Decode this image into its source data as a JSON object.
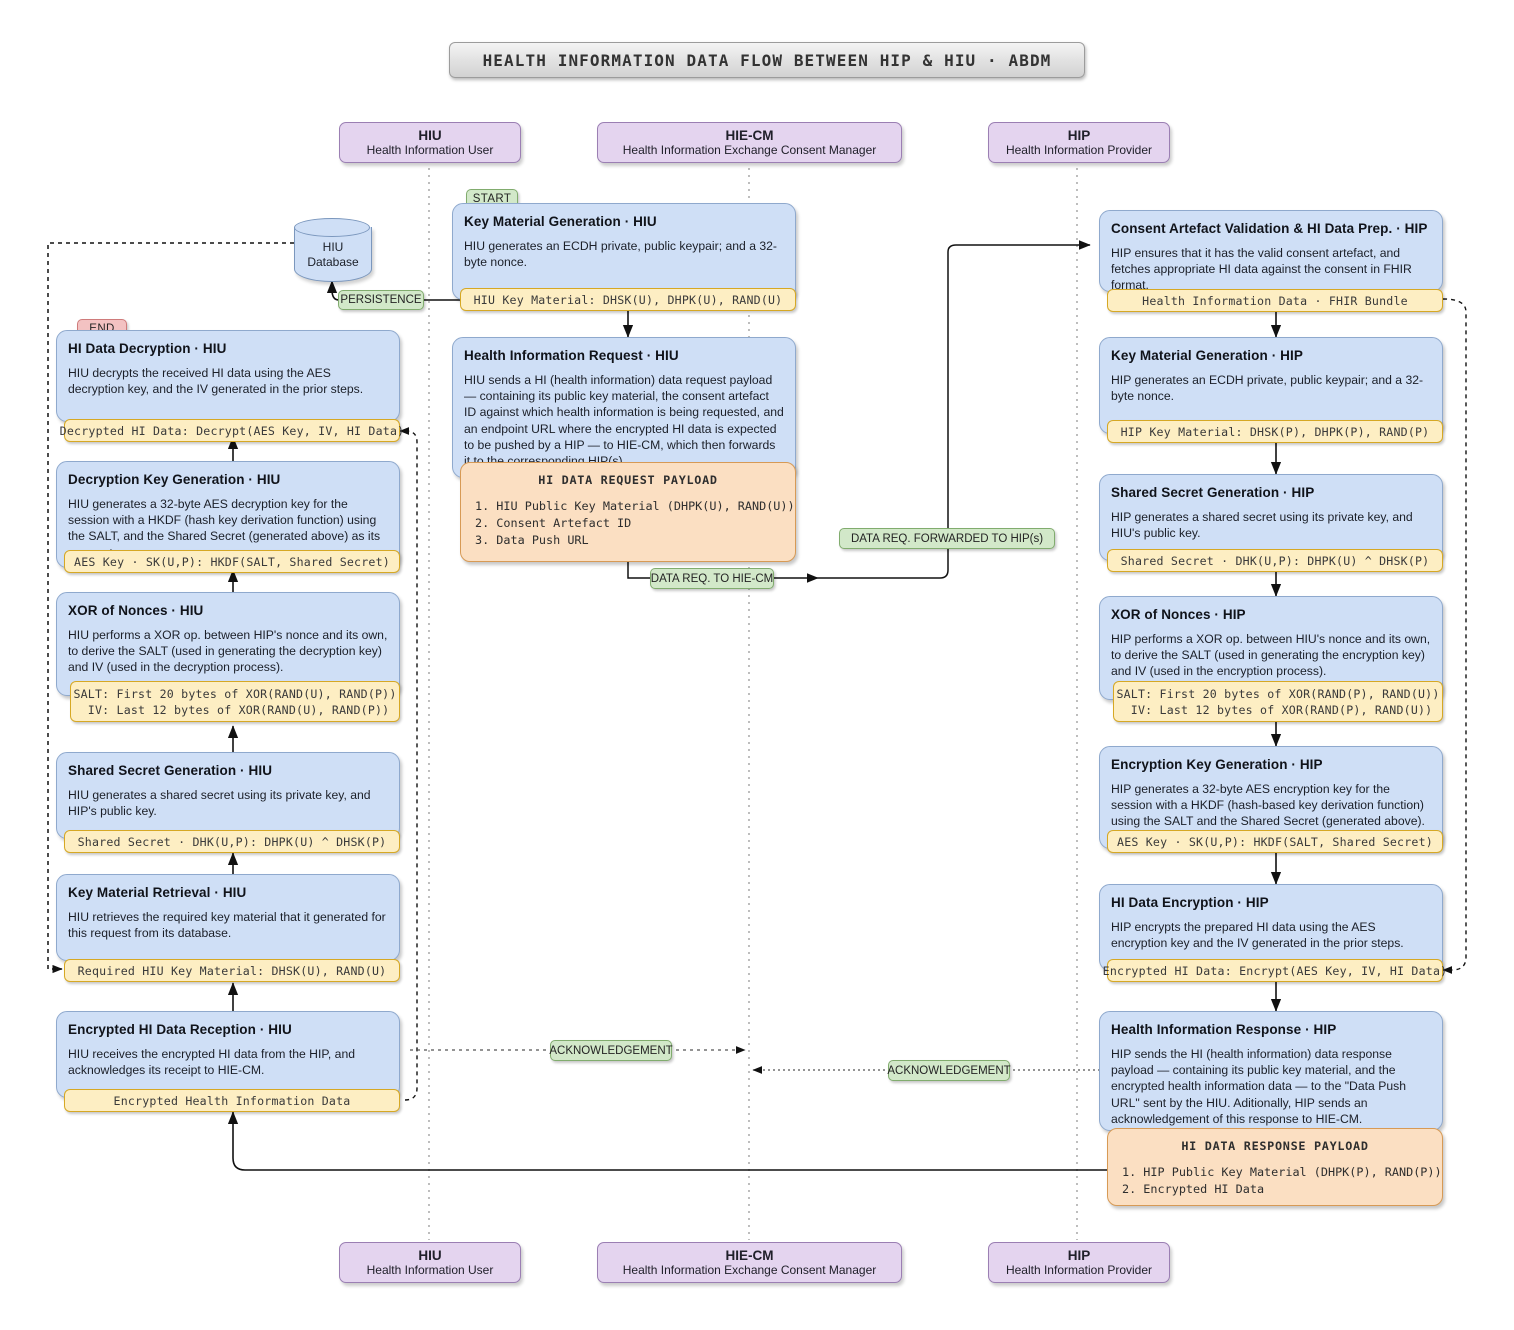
{
  "title": "HEALTH INFORMATION DATA FLOW BETWEEN HIP & HIU · ABDM",
  "participants": [
    {
      "abbr": "HIU",
      "full": "Health Information User"
    },
    {
      "abbr": "HIE-CM",
      "full": "Health Information Exchange Consent Manager"
    },
    {
      "abbr": "HIP",
      "full": "Health Information Provider"
    }
  ],
  "database": {
    "line1": "HIU",
    "line2": "Database"
  },
  "tags": {
    "start": "START",
    "end": "END",
    "persistence": "PERSISTENCE",
    "data_req_to_cm": "DATA REQ. TO HIE-CM",
    "data_req_forwarded": "DATA REQ. FORWARDED TO HIP(s)",
    "ack_left": "ACKNOWLEDGEMENT",
    "ack_right": "ACKNOWLEDGEMENT"
  },
  "middle": {
    "key_material_generation_hiu": {
      "title": "Key Material Generation · HIU",
      "body": "HIU generates an ECDH private, public keypair; and a 32-byte nonce.",
      "artifact": "HIU Key Material: DHSK(U), DHPK(U), RAND(U)"
    },
    "health_information_request_hiu": {
      "title": "Health Information Request · HIU",
      "body": "HIU sends a HI (health information) data request payload — containing its public key material, the consent artefact ID against which health information is being requested, and an endpoint URL where the encrypted HI data is expected to be pushed by a HIP — to HIE-CM, which then forwards it to the corresponding HIP(s).",
      "payload_title": "HI DATA REQUEST PAYLOAD",
      "payload_items": [
        "1. HIU Public Key Material (DHPK(U), RAND(U))",
        "2. Consent Artefact ID",
        "3. Data Push URL"
      ]
    }
  },
  "hiu_steps": [
    {
      "title": "HI Data Decryption · HIU",
      "body": "HIU decrypts the received HI data using the AES decryption key, and the IV generated in the prior steps.",
      "artifact": "Decrypted HI Data: Decrypt(AES Key, IV, HI Data)"
    },
    {
      "title": "Decryption Key Generation · HIU",
      "body": "HIU generates a 32-byte AES decryption key for the session with a HKDF (hash key derivation function) using the SALT, and the Shared Secret (generated above) as its parameters.",
      "artifact": "AES Key · SK(U,P): HKDF(SALT, Shared Secret)"
    },
    {
      "title": "XOR of Nonces · HIU",
      "body": "HIU performs a XOR op. between HIP's nonce and its own, to derive the SALT (used in generating the decryption key) and IV (used in the decryption process).",
      "artifact": "SALT: First 20 bytes of XOR(RAND(U), RAND(P))\n  IV: Last 12 bytes of XOR(RAND(U), RAND(P))"
    },
    {
      "title": "Shared Secret Generation · HIU",
      "body": "HIU generates a shared secret using its private key, and HIP's public key.",
      "artifact": "Shared Secret · DHK(U,P): DHPK(U) ^ DHSK(P)"
    },
    {
      "title": "Key Material Retrieval · HIU",
      "body": "HIU retrieves the required key material that it generated for this request from its database.",
      "artifact": "Required HIU Key Material: DHSK(U), RAND(U)"
    },
    {
      "title": "Encrypted HI Data Reception · HIU",
      "body": "HIU receives the encrypted HI data from the HIP, and acknowledges its receipt to HIE-CM.",
      "artifact": "Encrypted Health Information Data"
    }
  ],
  "hip_steps": [
    {
      "title": "Consent Artefact Validation & HI Data Prep. · HIP",
      "body": "HIP ensures that it has the valid consent artefact, and fetches appropriate HI data against the consent in FHIR format.",
      "artifact": "Health Information Data · FHIR Bundle"
    },
    {
      "title": "Key Material Generation · HIP",
      "body": "HIP generates an ECDH private, public keypair; and a 32-byte nonce.",
      "artifact": "HIP Key Material: DHSK(P), DHPK(P), RAND(P)"
    },
    {
      "title": "Shared Secret Generation · HIP",
      "body": "HIP generates a shared secret using its private key, and HIU's public key.",
      "artifact": "Shared Secret · DHK(U,P): DHPK(U) ^ DHSK(P)"
    },
    {
      "title": "XOR of Nonces · HIP",
      "body": "HIP performs a XOR op. between HIU's nonce and its own, to derive the SALT (used in generating the encryption key) and IV (used in the encryption process).",
      "artifact": "SALT: First 20 bytes of XOR(RAND(P), RAND(U))\n  IV: Last 12 bytes of XOR(RAND(P), RAND(U))"
    },
    {
      "title": "Encryption Key Generation · HIP",
      "body": "HIP generates a 32-byte AES encryption key for the session with a HKDF (hash-based key derivation function) using the SALT and the Shared Secret (generated above).",
      "artifact": "AES Key · SK(U,P): HKDF(SALT, Shared Secret)"
    },
    {
      "title": "HI Data Encryption · HIP",
      "body": "HIP encrypts the prepared HI data using the AES encryption key and the IV generated in the prior steps.",
      "artifact": "Encrypted HI Data: Encrypt(AES Key, IV, HI Data)"
    }
  ],
  "hip_response": {
    "title": "Health Information Response · HIP",
    "body": "HIP sends the HI (health information) data response payload — containing its public key material, and the encrypted health information data — to the \"Data Push URL\" sent by the HIU. Aditionally, HIP sends an acknowledgement of this response to HIE-CM.",
    "payload_title": "HI DATA RESPONSE PAYLOAD",
    "payload_items": [
      "1. HIP Public Key Material (DHPK(P), RAND(P))",
      "2. Encrypted HI Data"
    ]
  },
  "colors": {
    "card": "#cfdff6",
    "artifact": "#fdeec3",
    "payload": "#fbdfc2",
    "participant": "#e4d4ef",
    "tag_green": "#d2e8c9",
    "tag_red": "#f3c2c2"
  }
}
